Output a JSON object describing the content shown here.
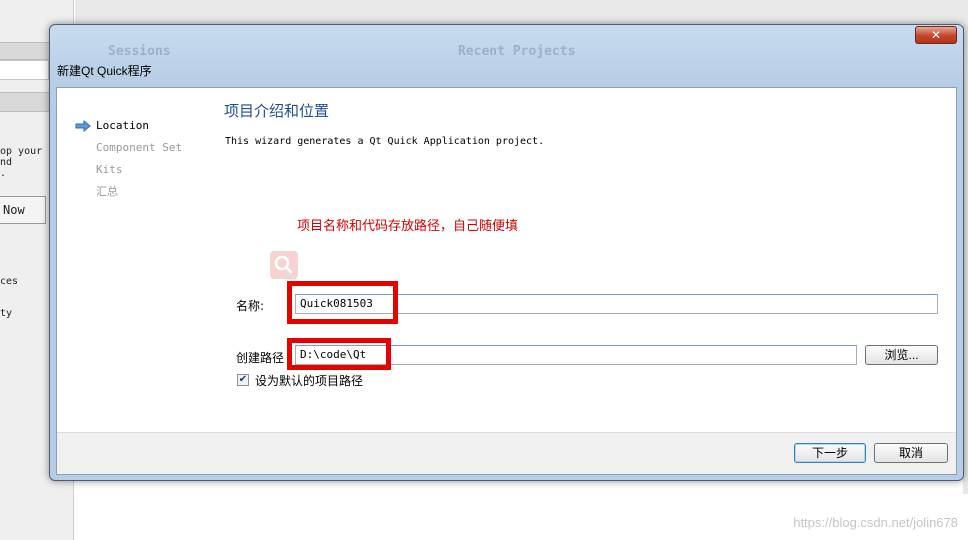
{
  "background": {
    "tab_left": "Sessions",
    "tab_right": "Recent Projects",
    "left_text_1": "op your\nnd\n.",
    "button_label": "Now",
    "left_text_2": "ces",
    "left_text_3": "ty"
  },
  "dialog": {
    "title": "新建Qt Quick程序",
    "close_glyph": "✕",
    "steps": [
      {
        "label": "Location",
        "active": true
      },
      {
        "label": "Component Set",
        "active": false
      },
      {
        "label": "Kits",
        "active": false
      },
      {
        "label": "汇总",
        "active": false
      }
    ],
    "page_title": "项目介绍和位置",
    "description": "This wizard generates a Qt Quick Application project.",
    "annotation": "项目名称和代码存放路径，自己随便填",
    "name_label": "名称:",
    "name_value": "Quick081503",
    "path_label": "创建路径",
    "path_value": "D:\\code\\Qt",
    "browse_label": "浏览...",
    "default_path_checkbox": {
      "label": "设为默认的项目路径",
      "checked": true
    },
    "next_label": "下一步",
    "cancel_label": "取消"
  },
  "watermark": "https://blog.csdn.net/jolin678",
  "colors": {
    "highlight": "#e60000",
    "title_blue": "#1f4e8c",
    "annotation_red": "#d40000"
  }
}
